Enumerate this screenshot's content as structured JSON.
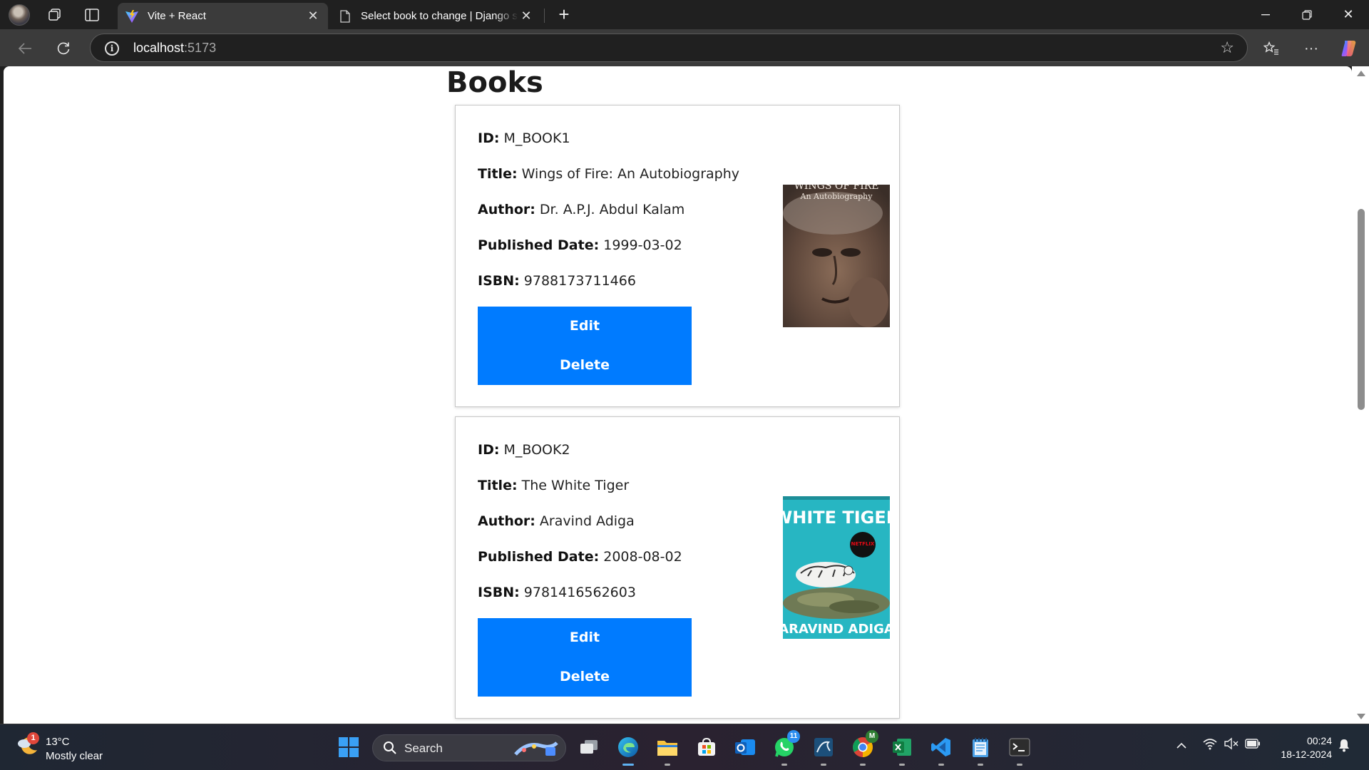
{
  "browser": {
    "tabs": [
      {
        "title": "Vite + React",
        "active": true
      },
      {
        "title": "Select book to change | Django si",
        "active": false
      }
    ],
    "address": {
      "host": "localhost",
      "port": ":5173"
    }
  },
  "page": {
    "heading": "Books",
    "field_labels": {
      "id": "ID:",
      "title": "Title:",
      "author": "Author:",
      "published_date": "Published Date:",
      "isbn": "ISBN:"
    },
    "edit_label": "Edit",
    "delete_label": "Delete",
    "books": [
      {
        "id": "M_BOOK1",
        "title": "Wings of Fire: An Autobiography",
        "author": "Dr. A.P.J. Abdul Kalam",
        "published_date": "1999-03-02",
        "isbn": "9788173711466",
        "cover_text": [
          "WINGS OF FIRE",
          "An Autobiography"
        ]
      },
      {
        "id": "M_BOOK2",
        "title": "The White Tiger",
        "author": "Aravind Adiga",
        "published_date": "2008-08-02",
        "isbn": "9781416562603",
        "cover_text": [
          "WHITE TIGER",
          "ARAVIND ADIGA",
          "NETFLIX"
        ]
      }
    ]
  },
  "taskbar": {
    "weather": {
      "temp": "13°C",
      "desc": "Mostly clear",
      "badge": "1"
    },
    "search_label": "Search",
    "whatsapp_badge": "11",
    "chrome_profile": "M",
    "clock": {
      "time": "00:24",
      "date": "18-12-2024"
    }
  },
  "colors": {
    "button": "#007bff",
    "browser_chrome": "#202020",
    "toolbar": "#3b3b3b"
  }
}
